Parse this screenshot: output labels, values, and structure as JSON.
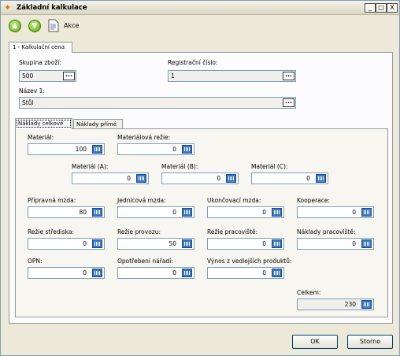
{
  "window": {
    "title": "Základní kalkulace",
    "min": "_",
    "max": "□",
    "close": "X"
  },
  "toolbar": {
    "akce": "Akce"
  },
  "outer_tab": {
    "label": "1 - Kalkulační cena"
  },
  "header": {
    "skupina_label": "Skupina zboží:",
    "skupina_value": "500",
    "registracni_label": "Registrační číslo:",
    "registracni_value": "1",
    "nazev_label": "Název 1:",
    "nazev_value": "Stůl",
    "dots": "..."
  },
  "tabs": {
    "celkove": "Náklady celkové",
    "prime": "Náklady přímé"
  },
  "fields": {
    "material": {
      "label": "Materiál:",
      "value": "100"
    },
    "materialova_rezie": {
      "label": "Materiálová režie:",
      "value": "0"
    },
    "material_a": {
      "label": "Materiál (A):",
      "value": "0"
    },
    "material_b": {
      "label": "Materiál (B):",
      "value": "0"
    },
    "material_c": {
      "label": "Materiál (C):",
      "value": "0"
    },
    "pripravna_mzda": {
      "label": "Přípravná mzda:",
      "value": "80"
    },
    "jednicova_mzda": {
      "label": "Jednicová mzda:",
      "value": "0"
    },
    "ukoncovaci_mzda": {
      "label": "Ukončovací mzda:",
      "value": "0"
    },
    "kooperace": {
      "label": "Kooperace:",
      "value": "0"
    },
    "rezie_strediska": {
      "label": "Režie střediska:",
      "value": "0"
    },
    "rezie_provozu": {
      "label": "Režie provozu:",
      "value": "50"
    },
    "rezie_pracoviste": {
      "label": "Režie pracoviště:",
      "value": "0"
    },
    "naklady_pracoviste": {
      "label": "Náklady pracoviště:",
      "value": "0"
    },
    "opn": {
      "label": "OPN:",
      "value": "0"
    },
    "opotrebeni": {
      "label": "Opotřebení nářadí:",
      "value": "0"
    },
    "vynos": {
      "label": "Výnos z vedlejších produktů:",
      "value": "0"
    },
    "celkem": {
      "label": "Celkem:",
      "value": "230"
    }
  },
  "buttons": {
    "ok": "OK",
    "storno": "Storno"
  }
}
